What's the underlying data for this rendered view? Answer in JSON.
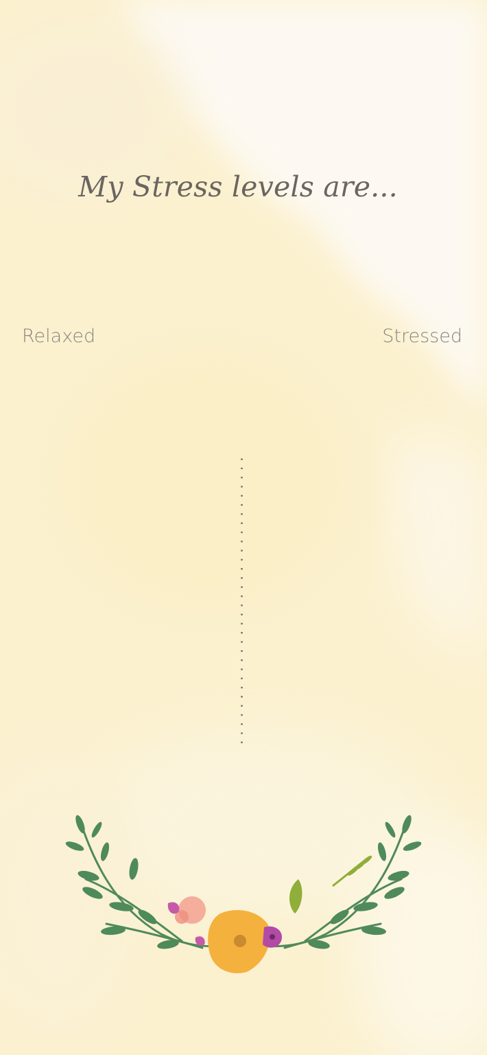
{
  "screen": {
    "title": "My Stress levels are...",
    "scale": {
      "left_label": "Relaxed",
      "right_label": "Stressed"
    }
  },
  "theme": {
    "background": "#fbf3d6",
    "wash_light": "#fdf9f2",
    "title_color": "#6b6561",
    "label_color": "#8a847e",
    "dot_color": "#6e6964"
  },
  "decoration": {
    "icon": "floral-wreath-icon"
  }
}
